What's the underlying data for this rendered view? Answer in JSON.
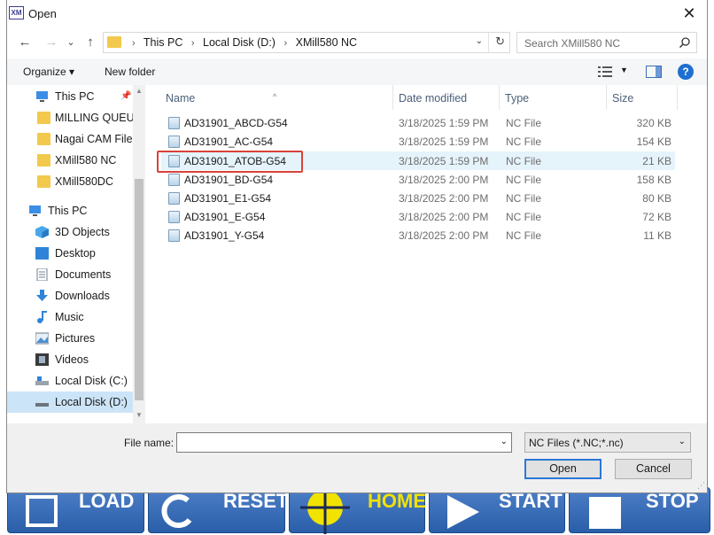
{
  "window": {
    "title": "Open",
    "close_glyph": "✕",
    "app_icon_text": "XM"
  },
  "nav": {
    "back_glyph": "←",
    "forward_glyph": "→",
    "recent_glyph": "⌄",
    "up_glyph": "↑",
    "breadcrumbs": [
      "This PC",
      "Local Disk (D:)",
      "XMill580 NC"
    ],
    "crumb_sep": "›",
    "search_placeholder": "Search XMill580 NC"
  },
  "toolbar": {
    "organize": "Organize ▾",
    "new_folder": "New folder",
    "help": "?"
  },
  "sidebar": {
    "items": [
      {
        "label": "This PC",
        "icon": "monitor-icon",
        "pinned": true
      },
      {
        "label": "MILLING QUEUE",
        "icon": "folder-icon"
      },
      {
        "label": "Nagai CAM Files",
        "icon": "folder-icon"
      },
      {
        "label": "XMill580 NC",
        "icon": "folder-icon"
      },
      {
        "label": "XMill580DC",
        "icon": "folder-icon"
      },
      {
        "label": "This PC",
        "icon": "monitor-icon"
      },
      {
        "label": "3D Objects",
        "icon": "cube-icon"
      },
      {
        "label": "Desktop",
        "icon": "desktop-icon"
      },
      {
        "label": "Documents",
        "icon": "document-icon"
      },
      {
        "label": "Downloads",
        "icon": "download-icon"
      },
      {
        "label": "Music",
        "icon": "music-icon"
      },
      {
        "label": "Pictures",
        "icon": "pictures-icon"
      },
      {
        "label": "Videos",
        "icon": "video-icon"
      },
      {
        "label": "Local Disk (C:)",
        "icon": "drive-icon"
      },
      {
        "label": "Local Disk (D:)",
        "icon": "drive-icon",
        "selected": true
      }
    ]
  },
  "columns": {
    "name": "Name",
    "date": "Date modified",
    "type": "Type",
    "size": "Size"
  },
  "files": [
    {
      "name": "AD31901_ABCD-G54",
      "date": "3/18/2025 1:59 PM",
      "type": "NC File",
      "size": "320 KB"
    },
    {
      "name": "AD31901_AC-G54",
      "date": "3/18/2025 1:59 PM",
      "type": "NC File",
      "size": "154 KB"
    },
    {
      "name": "AD31901_ATOB-G54",
      "date": "3/18/2025 1:59 PM",
      "type": "NC File",
      "size": "21 KB",
      "highlighted": true
    },
    {
      "name": "AD31901_BD-G54",
      "date": "3/18/2025 2:00 PM",
      "type": "NC File",
      "size": "158 KB"
    },
    {
      "name": "AD31901_E1-G54",
      "date": "3/18/2025 2:00 PM",
      "type": "NC File",
      "size": "80 KB"
    },
    {
      "name": "AD31901_E-G54",
      "date": "3/18/2025 2:00 PM",
      "type": "NC File",
      "size": "72 KB"
    },
    {
      "name": "AD31901_Y-G54",
      "date": "3/18/2025 2:00 PM",
      "type": "NC File",
      "size": "11 KB"
    }
  ],
  "footer": {
    "file_name_label": "File name:",
    "file_name_value": "",
    "filter": "NC Files (*.NC;*.nc)",
    "open": "Open",
    "cancel": "Cancel"
  },
  "background_app": {
    "buttons": [
      "LOAD",
      "RESET",
      "HOME",
      "START",
      "STOP"
    ]
  },
  "colors": {
    "accent": "#2b78d6",
    "selection": "#cce4f7",
    "highlight_box": "#d9423a",
    "app_button": "#2a5ea8"
  }
}
